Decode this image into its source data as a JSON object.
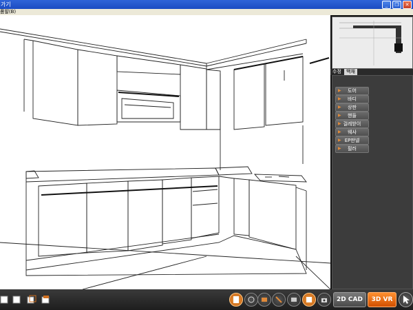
{
  "window": {
    "title": "가기"
  },
  "menu": {
    "items": [
      "품발(B)"
    ]
  },
  "panel": {
    "tabs": [
      {
        "label": "수정"
      },
      {
        "label": "백채"
      }
    ],
    "buttons": [
      {
        "label": "도어"
      },
      {
        "label": "바디"
      },
      {
        "label": "상판"
      },
      {
        "label": "핸들"
      },
      {
        "label": "걸레받이"
      },
      {
        "label": "웨사"
      },
      {
        "label": "EP판넬"
      },
      {
        "label": "필러"
      }
    ]
  },
  "toolbar": {
    "cad2d_label": "2D CAD",
    "vr3d_label": "3D VR"
  },
  "colors": {
    "accent": "#e67a1c",
    "panel_bg": "#3c3c3c",
    "titlebar": "#1b4cc2"
  }
}
